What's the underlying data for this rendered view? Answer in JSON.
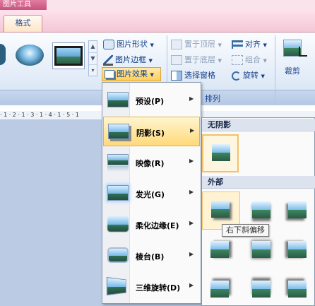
{
  "context_tab": "图片工具",
  "tabs": [
    {
      "label": "格式"
    }
  ],
  "ribbon": {
    "commands_left": {
      "shape": "图片形状",
      "border": "图片边框",
      "effects": "图片效果"
    },
    "arrange": {
      "bring_front": "置于顶层",
      "send_back": "置于底层",
      "selection_pane": "选择窗格",
      "align": "对齐",
      "group": "组合",
      "rotate": "旋转",
      "group_label": "排列"
    },
    "crop": "裁剪",
    "gallery_scroll": [
      "▲",
      "▼",
      "▾"
    ]
  },
  "ruler_text": "· 1 · 2 · 1 · 3 · 1 · 4 · 1 · 5 · 1",
  "effects_menu": {
    "items": [
      {
        "label": "预设(P)",
        "icon": "preset-icon"
      },
      {
        "label": "阴影(S)",
        "icon": "shadow-icon",
        "active": true
      },
      {
        "label": "映像(R)",
        "icon": "reflection-icon"
      },
      {
        "label": "发光(G)",
        "icon": "glow-icon"
      },
      {
        "label": "柔化边缘(E)",
        "icon": "soft-edges-icon"
      },
      {
        "label": "棱台(B)",
        "icon": "bevel-icon"
      },
      {
        "label": "三维旋转(D)",
        "icon": "3d-rotation-icon"
      }
    ],
    "arrow": "▶"
  },
  "shadow_submenu": {
    "no_shadow_heading": "无阴影",
    "outer_heading": "外部",
    "tooltip": "右下斜偏移"
  },
  "colors": {
    "context_pink": "#c9527c",
    "ribbon_blue": "#d3e0f2",
    "menu_highlight": "#ffd97a",
    "text_blue": "#15428b"
  }
}
